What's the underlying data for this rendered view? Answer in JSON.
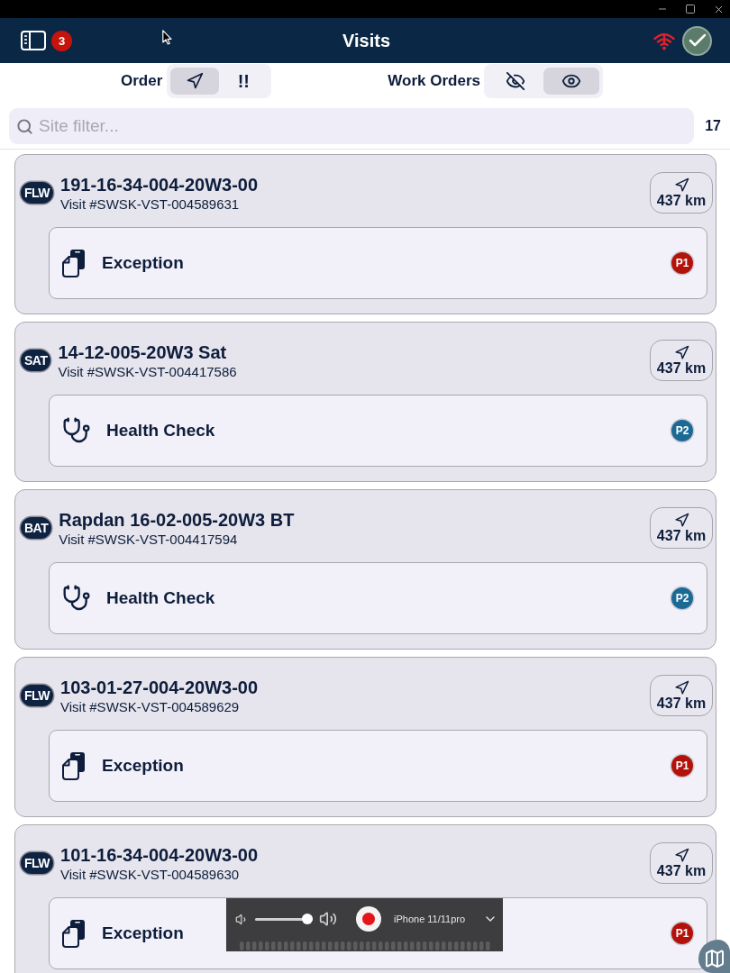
{
  "header": {
    "title": "Visits",
    "badge": "3"
  },
  "toolbar": {
    "order": {
      "label": "Order",
      "options": [
        {
          "kind": "distance",
          "selected": true
        },
        {
          "kind": "priority",
          "text": "!!",
          "selected": false
        }
      ]
    },
    "work_orders": {
      "label": "Work Orders",
      "options": [
        {
          "kind": "hidden",
          "selected": false
        },
        {
          "kind": "visible",
          "selected": true
        }
      ]
    }
  },
  "filter": {
    "placeholder": "Site filter...",
    "count": "17"
  },
  "visits": [
    {
      "tag": "FLW",
      "site": "191-16-34-004-20W3-00",
      "visit": "Visit #SWSK-VST-004589631",
      "distance": "437 km",
      "work_order": {
        "kind": "exception",
        "label": "Exception",
        "priority": "P1",
        "color": "#b3120b"
      }
    },
    {
      "tag": "SAT",
      "site": "14-12-005-20W3 Sat",
      "visit": "Visit #SWSK-VST-004417586",
      "distance": "437 km",
      "work_order": {
        "kind": "health_check",
        "label": "Health Check",
        "priority": "P2",
        "color": "#1b6a96"
      }
    },
    {
      "tag": "BAT",
      "site": "Rapdan 16-02-005-20W3 BT",
      "visit": "Visit #SWSK-VST-004417594",
      "distance": "437 km",
      "work_order": {
        "kind": "health_check",
        "label": "Health Check",
        "priority": "P2",
        "color": "#1b6a96"
      }
    },
    {
      "tag": "FLW",
      "site": "103-01-27-004-20W3-00",
      "visit": "Visit #SWSK-VST-004589629",
      "distance": "437 km",
      "work_order": {
        "kind": "exception",
        "label": "Exception",
        "priority": "P1",
        "color": "#b3120b"
      }
    },
    {
      "tag": "FLW",
      "site": "101-16-34-004-20W3-00",
      "visit": "Visit #SWSK-VST-004589630",
      "distance": "437 km",
      "work_order": {
        "kind": "exception",
        "label": "Exception",
        "priority": "P1",
        "color": "#b3120b"
      }
    }
  ],
  "recorder": {
    "device": "iPhone 11/11pro",
    "level": 1
  }
}
